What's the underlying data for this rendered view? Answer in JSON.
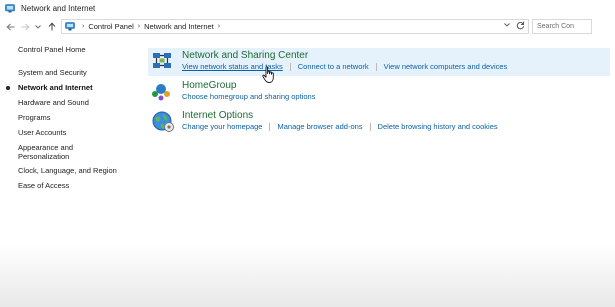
{
  "window": {
    "title": "Network and Internet"
  },
  "address": {
    "crumbs": [
      "Control Panel",
      "Network and Internet"
    ],
    "search_placeholder": "Search Con"
  },
  "sidebar": {
    "home": "Control Panel Home",
    "items": [
      {
        "label": "System and Security",
        "current": false
      },
      {
        "label": "Network and Internet",
        "current": true
      },
      {
        "label": "Hardware and Sound",
        "current": false
      },
      {
        "label": "Programs",
        "current": false
      },
      {
        "label": "User Accounts",
        "current": false
      },
      {
        "label": "Appearance and",
        "label2": "Personalization",
        "current": false
      },
      {
        "label": "Clock, Language, and Region",
        "current": false
      },
      {
        "label": "Ease of Access",
        "current": false
      }
    ]
  },
  "categories": [
    {
      "title": "Network and Sharing Center",
      "icon": "network-sharing-icon",
      "links": [
        "View network status and tasks",
        "Connect to a network",
        "View network computers and devices"
      ]
    },
    {
      "title": "HomeGroup",
      "icon": "homegroup-icon",
      "links": [
        "Choose homegroup and sharing options"
      ]
    },
    {
      "title": "Internet Options",
      "icon": "internet-options-icon",
      "links": [
        "Change your homepage",
        "Manage browser add-ons",
        "Delete browsing history and cookies"
      ]
    }
  ],
  "colors": {
    "category_title": "#1e6b33",
    "link": "#0b61a4",
    "highlight": "#e5f1fb"
  }
}
